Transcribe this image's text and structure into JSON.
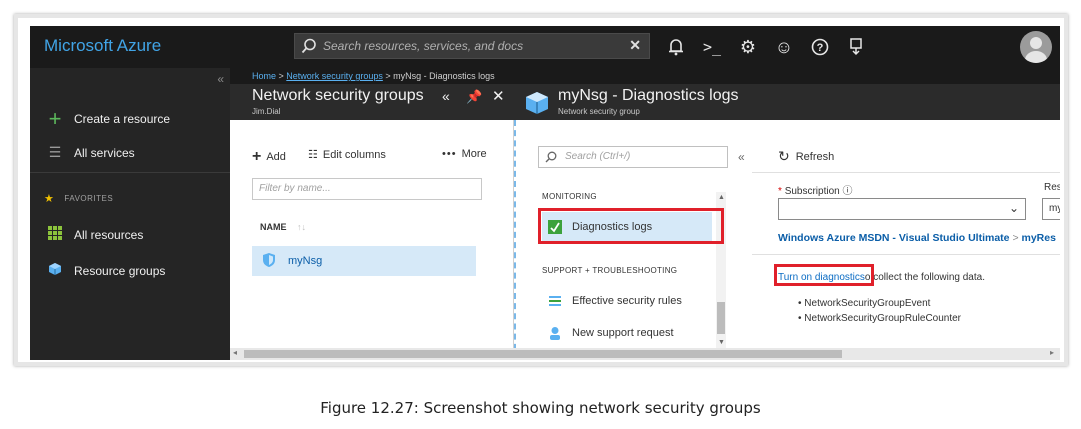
{
  "topbar": {
    "brand": "Microsoft Azure",
    "search_placeholder": "Search resources, services, and docs"
  },
  "sidebar": {
    "items": [
      {
        "label": "Create a resource",
        "icon": "plus-icon"
      },
      {
        "label": "All services",
        "icon": "list-icon"
      }
    ],
    "favorites_label": "FAVORITES",
    "favorites": [
      {
        "label": "All resources",
        "icon": "grid-icon"
      },
      {
        "label": "Resource groups",
        "icon": "cube-icon"
      }
    ]
  },
  "breadcrumb": {
    "home": "Home",
    "nsg": "Network security groups",
    "current": "myNsg - Diagnostics logs"
  },
  "blade1": {
    "title": "Network security groups",
    "subtitle": "Jim.Dial",
    "add_label": "Add",
    "edit_columns_label": "Edit columns",
    "more_label": "More",
    "filter_placeholder": "Filter by name...",
    "column_name": "NAME",
    "rows": [
      {
        "name": "myNsg"
      }
    ]
  },
  "blade2": {
    "title": "myNsg - Diagnostics logs",
    "subtitle": "Network security group",
    "search_placeholder": "Search (Ctrl+/)",
    "section_monitoring": "MONITORING",
    "diagnostics_logs": "Diagnostics logs",
    "section_support": "SUPPORT + TROUBLESHOOTING",
    "effective_rules": "Effective security rules",
    "new_support": "New support request"
  },
  "blade3": {
    "refresh_label": "Refresh",
    "subscription_label": "Subscription",
    "resource_label_partial": "Reso",
    "resource_value_partial": "my",
    "path_subscription": "Windows Azure MSDN - Visual Studio Ultimate",
    "path_resource_partial": "myRes",
    "turn_on_link": "Turn on diagnostics",
    "turn_on_suffix": "o collect the following data.",
    "bullets": [
      "NetworkSecurityGroupEvent",
      "NetworkSecurityGroupRuleCounter"
    ]
  },
  "caption": "Figure 12.27: Screenshot showing network security groups"
}
